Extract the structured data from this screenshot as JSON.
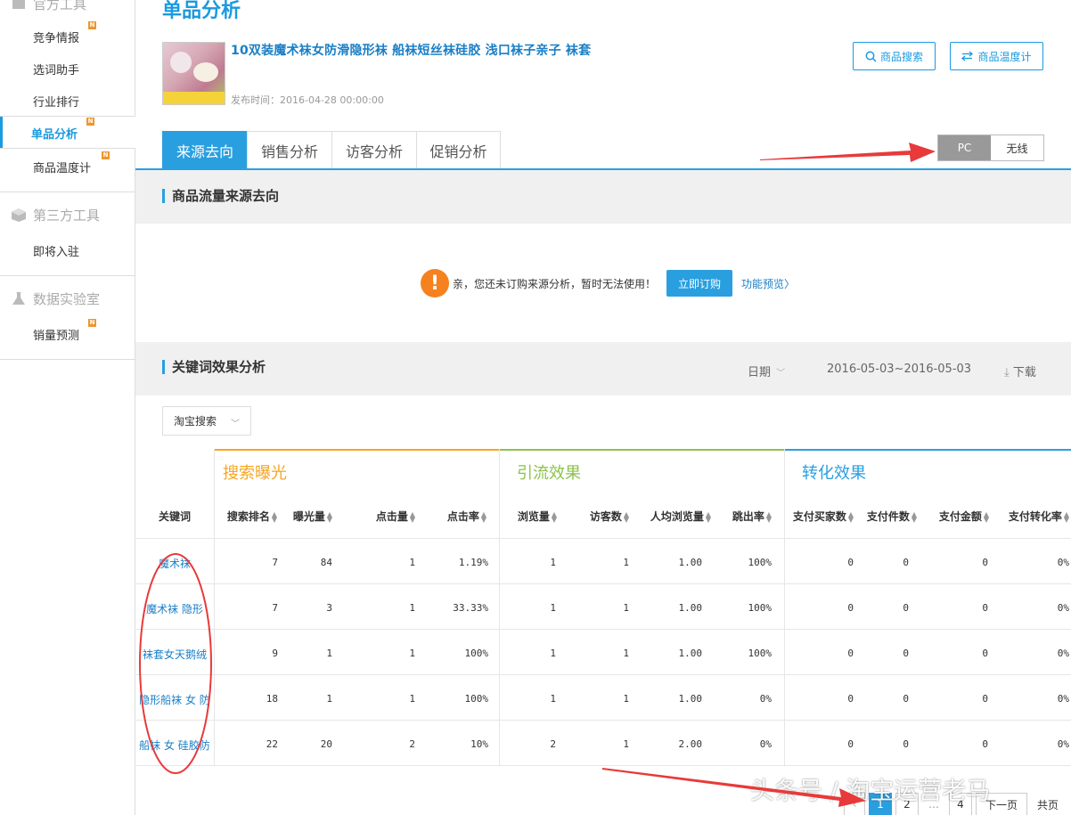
{
  "sidebar": {
    "top_header": "官方工具",
    "items": [
      {
        "label": "竞争情报",
        "badge": "N"
      },
      {
        "label": "选词助手",
        "badge": ""
      },
      {
        "label": "行业排行",
        "badge": ""
      },
      {
        "label": "单品分析",
        "badge": "N"
      },
      {
        "label": "商品温度计",
        "badge": "N"
      }
    ],
    "section2_header": "第三方工具",
    "section2_items": [
      {
        "label": "即将入驻"
      }
    ],
    "section3_header": "数据实验室",
    "section3_items": [
      {
        "label": "销量预测",
        "badge": "N"
      }
    ]
  },
  "page": {
    "title": "单品分析",
    "product_title": "10双装魔术袜女防滑隐形袜 船袜短丝袜硅胶 浅口袜子亲子 袜套",
    "publish_time": "发布时间：2016-04-28 00:00:00",
    "btn_search": "商品搜索",
    "btn_thermo": "商品温度计"
  },
  "tabs": [
    "来源去向",
    "销售分析",
    "访客分析",
    "促销分析"
  ],
  "device_toggle": {
    "pc": "PC",
    "wireless": "无线"
  },
  "traffic": {
    "title": "商品流量来源去向",
    "notice": "亲，您还未订购来源分析，暂时无法使用！",
    "subscribe": "立即订购",
    "preview": "功能预览〉",
    "warn_glyph": "!"
  },
  "keywords": {
    "title": "关键词效果分析",
    "date_label": "日期",
    "date_value": "2016-05-03~2016-05-03",
    "download": "下载",
    "channel": "淘宝搜索",
    "groups": [
      "搜索曝光",
      "引流效果",
      "转化效果"
    ],
    "headers": [
      "关键词",
      "搜索排名",
      "曝光量",
      "点击量",
      "点击率",
      "浏览量",
      "访客数",
      "人均浏览量",
      "跳出率",
      "支付买家数",
      "支付件数",
      "支付金额",
      "支付转化率"
    ],
    "rows": [
      [
        "魔术袜",
        "7",
        "84",
        "1",
        "1.19%",
        "1",
        "1",
        "1.00",
        "100%",
        "0",
        "0",
        "0",
        "0%"
      ],
      [
        "魔术袜 隐形",
        "7",
        "3",
        "1",
        "33.33%",
        "1",
        "1",
        "1.00",
        "100%",
        "0",
        "0",
        "0",
        "0%"
      ],
      [
        "袜套女天鹅绒",
        "9",
        "1",
        "1",
        "100%",
        "1",
        "1",
        "1.00",
        "100%",
        "0",
        "0",
        "0",
        "0%"
      ],
      [
        "隐形船袜 女 防",
        "18",
        "1",
        "1",
        "100%",
        "1",
        "1",
        "1.00",
        "0%",
        "0",
        "0",
        "0",
        "0%"
      ],
      [
        "船袜 女 硅胶防",
        "22",
        "20",
        "2",
        "10%",
        "2",
        "1",
        "2.00",
        "0%",
        "0",
        "0",
        "0",
        "0%"
      ]
    ]
  },
  "pager": {
    "pages": [
      "1",
      "2",
      "4"
    ],
    "next": "下一页",
    "total": "共页"
  },
  "watermark": "头条号 / 淘宝运营老马",
  "colors": {
    "accent": "#2a9fe0",
    "orange": "#f5a623",
    "green": "#8bc34a",
    "arrow": "#e83a3a"
  }
}
